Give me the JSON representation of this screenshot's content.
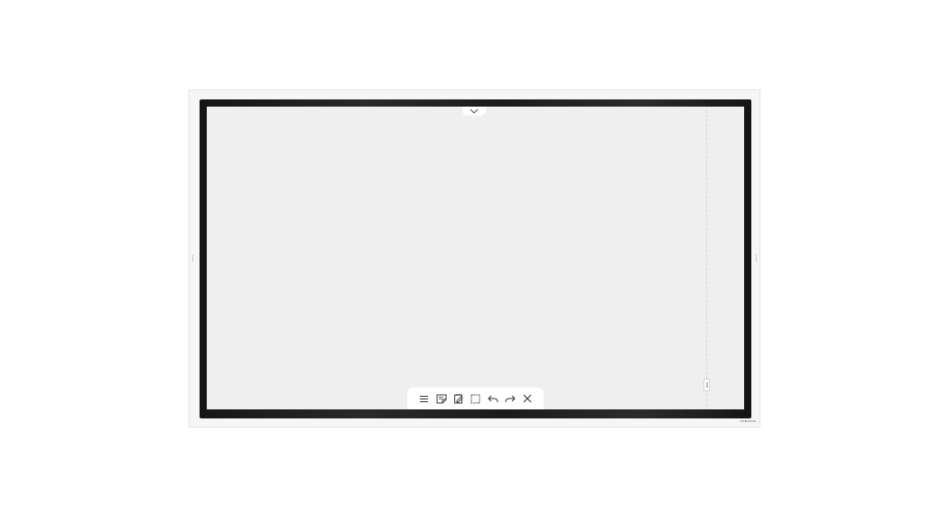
{
  "device": {
    "brand": "SAMSUNG",
    "bezel_color": "#1b1b1b",
    "frame_color": "#f6f6f6",
    "screen_color": "#efefef"
  },
  "top_tab": {
    "icon": "chevron-down-icon"
  },
  "toolbar": {
    "items": [
      {
        "name": "menu-button",
        "icon": "menu-icon"
      },
      {
        "name": "sticky-note-button",
        "icon": "sticky-note-icon"
      },
      {
        "name": "page-edit-button",
        "icon": "page-edit-icon"
      },
      {
        "name": "select-area-button",
        "icon": "select-area-icon"
      },
      {
        "name": "undo-button",
        "icon": "undo-icon"
      },
      {
        "name": "redo-button",
        "icon": "redo-icon"
      },
      {
        "name": "close-button",
        "icon": "close-icon"
      }
    ]
  },
  "side_panel": {
    "icon": "drag-handle-icon"
  }
}
